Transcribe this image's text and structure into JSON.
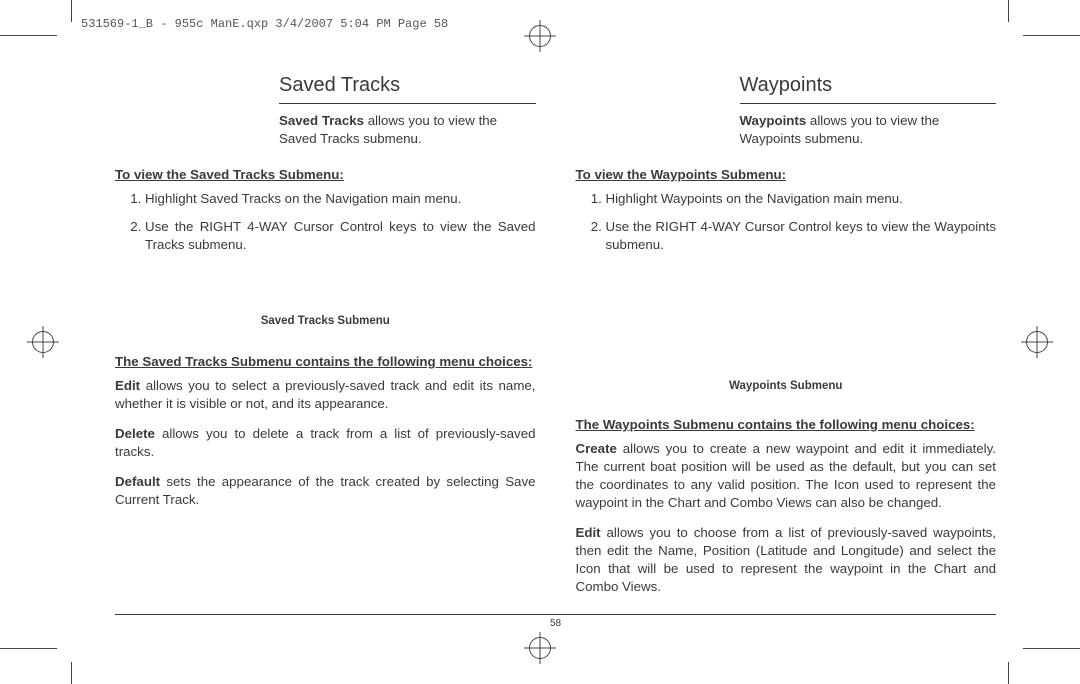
{
  "print_header": "531569-1_B - 955c ManE.qxp  3/4/2007  5:04 PM  Page 58",
  "page_number": "58",
  "left": {
    "title": "Saved Tracks",
    "intro_bold": "Saved Tracks",
    "intro_rest": " allows you to view the Saved Tracks submenu.",
    "view_head": "To view the Saved Tracks Submenu:",
    "step1": "Highlight Saved Tracks on the Navigation main menu.",
    "step2": "Use the RIGHT 4-WAY Cursor Control keys to view the Saved Tracks submenu.",
    "caption": "Saved Tracks Submenu",
    "choices_head": "The Saved Tracks Submenu contains the following menu choices:",
    "edit_bold": "Edit",
    "edit_rest": " allows you to select a previously-saved track and edit its name, whether it is visible or not, and its appearance.",
    "delete_bold": "Delete",
    "delete_rest": " allows you to delete a track from a list of previously-saved tracks.",
    "default_bold": "Default",
    "default_rest": " sets the appearance of the track created by selecting Save Current Track."
  },
  "right": {
    "title": "Waypoints",
    "intro_bold": "Waypoints",
    "intro_rest": " allows you to view the Waypoints submenu.",
    "view_head": "To view the Waypoints Submenu:",
    "step1": "Highlight Waypoints on the Navigation main menu.",
    "step2": "Use the RIGHT 4-WAY Cursor Control keys to view the Waypoints submenu.",
    "caption": "Waypoints Submenu",
    "choices_head": "The Waypoints Submenu contains the following menu choices:",
    "create_bold": "Create",
    "create_rest": " allows you to create a new waypoint and edit it immediately. The current boat position will be used as the default, but you can set the coordinates to any valid position. The Icon used to represent the waypoint in the Chart and Combo Views can also be changed.",
    "edit_bold": "Edit",
    "edit_rest": " allows you to choose from a list of previously-saved waypoints, then edit the Name, Position (Latitude and Longitude) and select the Icon that will be used to represent the waypoint in the Chart and Combo Views."
  }
}
